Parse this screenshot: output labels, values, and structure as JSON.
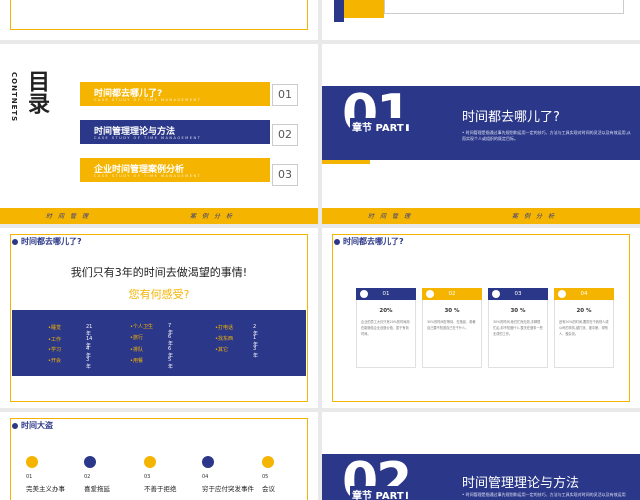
{
  "colors": {
    "navy": "#2b3788",
    "gold": "#f5b400",
    "bg": "#e9e9e9"
  },
  "toc": {
    "title_cn": "目录",
    "title_en": "CONTNETS",
    "items": [
      {
        "title": "时间都去哪儿了?",
        "sub": "CASE STUDY OF TIME MANAGEMENT",
        "num": "01"
      },
      {
        "title": "时间管理理论与方法",
        "sub": "CASE STUDY OF TIME MANAGEMENT",
        "num": "02"
      },
      {
        "title": "企业时间管理案例分析",
        "sub": "CASE STUDY OF TIME MANAGEMENT",
        "num": "03"
      }
    ],
    "strip_left": "时间管理",
    "strip_right": "案例分析"
  },
  "chapter1": {
    "big_num": "01",
    "chapter_label": "章节 PART",
    "title": "时间都去哪儿了?",
    "desc": "• 时间管理是指通过事先规划和运用一定的技巧、方法与工具实现对时间的灵活以及有效运用,从而实现个人或组织的既定目标。",
    "strip_left": "时间管理",
    "strip_right": "案例分析"
  },
  "slide5": {
    "section": "时间都去哪儿了?",
    "headline": "我们只有3年的时间去做渴望的事情!",
    "subline": "您有何感受?",
    "stats": [
      {
        "label": "•睡觉",
        "value": "21年"
      },
      {
        "label": "•个人卫生",
        "value": "7年"
      },
      {
        "label": "•打电话",
        "value": "2年"
      },
      {
        "label": "•工作",
        "value": "14年"
      },
      {
        "label": "•旅行",
        "value": "6年"
      },
      {
        "label": "•找东西",
        "value": "1年"
      },
      {
        "label": "•学习",
        "value": "4年"
      },
      {
        "label": "•排队",
        "value": "6年"
      },
      {
        "label": "•其它",
        "value": "3年"
      },
      {
        "label": "•开会",
        "value": "3年"
      },
      {
        "label": "•用餐",
        "value": "5年"
      }
    ]
  },
  "slide6": {
    "section": "时间都去哪儿了?",
    "cards": [
      {
        "num": "01",
        "pct": "20%",
        "text": "企业的员工大约只有20%的时间用在能够给企业创造价值、属于有效时间。",
        "color": "#2b3788"
      },
      {
        "num": "02",
        "pct": "30 %",
        "text": "30%的时间在等待、在拖延、看著自己要不知道自己在干什么。",
        "color": "#f5b400"
      },
      {
        "num": "03",
        "pct": "30 %",
        "text": "30%的时间,他们忙而无效,手脚很忙乱,却不知做什么,整天在做事一些无谓的工作。",
        "color": "#2b3788"
      },
      {
        "num": "04",
        "pct": "20 %",
        "text": "还有20%的时间,要防在干着别人或公司的事情,被打扰、被中断、帮别人、做杂务。",
        "color": "#f5b400"
      }
    ]
  },
  "slide7": {
    "section": "时间大盗",
    "steps": [
      {
        "num": "01",
        "label": "完美主义办事"
      },
      {
        "num": "02",
        "label": "喜爱拖延"
      },
      {
        "num": "03",
        "label": "不善于拒绝"
      },
      {
        "num": "04",
        "label": "穷于应付突发事件"
      },
      {
        "num": "05",
        "label": "会议"
      }
    ]
  },
  "chapter2": {
    "big_num": "02",
    "chapter_label": "章节 PART",
    "title": "时间管理理论与方法",
    "desc": "• 时间管理是指通过事先规划和运用一定的技巧、方法与工具实现对时间的灵活以及有效运用"
  }
}
